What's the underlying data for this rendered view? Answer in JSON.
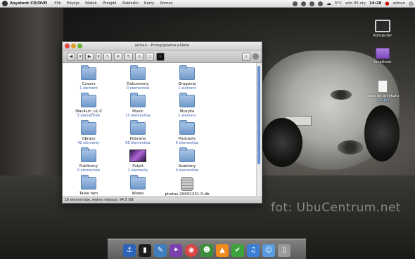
{
  "menubar": {
    "app_name": "Asystent CD/DVD",
    "items": [
      "Plik",
      "Edycja",
      "Widok",
      "Przejdź",
      "Zakładki",
      "Karty",
      "Pomoc"
    ],
    "temperature": "5°C",
    "datetime": "wto 05 sty",
    "time": "14:28",
    "user": "adrian"
  },
  "window": {
    "title": "adrian - Przeglądarka plików",
    "status": "16 elementów, wolne miejsce: 94,5 GB",
    "items": [
      {
        "name": "Covers",
        "count": "1 element",
        "icon": "folder"
      },
      {
        "name": "Dokumenty",
        "count": "0 elementów",
        "icon": "folder"
      },
      {
        "name": "Dragonia",
        "count": "1 element",
        "icon": "folder"
      },
      {
        "name": "Mac4Lin_v1.0",
        "count": "5 elementów",
        "icon": "folder"
      },
      {
        "name": "Music",
        "count": "15 elementów",
        "icon": "folder"
      },
      {
        "name": "Muzyka",
        "count": "1 element",
        "icon": "folder"
      },
      {
        "name": "Obrazy",
        "count": "42 elementy",
        "icon": "folder"
      },
      {
        "name": "Pobrane",
        "count": "66 elementów",
        "icon": "folder"
      },
      {
        "name": "Podcasts",
        "count": "0 elementów",
        "icon": "folder"
      },
      {
        "name": "Publiczny",
        "count": "0 elementów",
        "icon": "folder"
      },
      {
        "name": "Pulpit",
        "count": "2 elementy",
        "icon": "desktop"
      },
      {
        "name": "Szablony",
        "count": "0 elementów",
        "icon": "folder"
      },
      {
        "name": "Table fam",
        "count": "",
        "icon": "folder"
      },
      {
        "name": "Wideo",
        "count": "",
        "icon": "folder"
      },
      {
        "name": "photos-20091231-0.db",
        "count": "",
        "icon": "database"
      }
    ]
  },
  "desktop": {
    "computer": "Komputer",
    "localhost": "localhost",
    "file_name": "Szkielet artykułu",
    "file_size": "1,2 KB"
  },
  "dock": {
    "icons": [
      "anchor-icon",
      "terminal-icon",
      "quill-icon",
      "inkscape-icon",
      "chrome-icon",
      "pidgin-icon",
      "vlc-icon",
      "tasks-icon",
      "music-icon",
      "finder-icon",
      "trash-icon"
    ]
  },
  "watermark": "fot: UbuCentrum.net",
  "colors": {
    "accent": "#3a5fb0",
    "folder": "#7fa3d2",
    "link": "#9cc3ff"
  }
}
